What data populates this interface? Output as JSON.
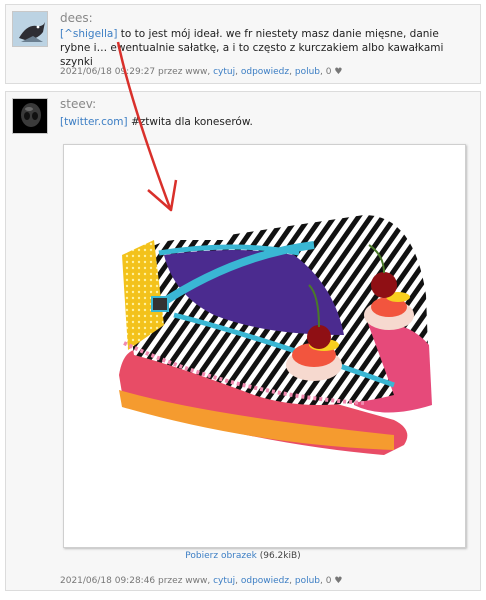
{
  "posts": [
    {
      "author": "dees:",
      "tag": "[^shigella]",
      "text": " to to jest mój ideał. we fr niestety masz danie mięsne, danie rybne i… ewentualnie sałatkę, a i to często z kurczakiem albo kawałkami szynki",
      "timestamp": "2021/06/18 09:29:27 przez www,",
      "actions": {
        "quote": "cytuj",
        "reply": "odpowiedz",
        "like": "polub"
      },
      "likes": "0 ♥"
    },
    {
      "author": "steev:",
      "link": "[twitter.com]",
      "hashtag": "#ztwita",
      "text": " dla koneserów.",
      "image_caption_link": "Pobierz obrazek",
      "image_caption_size": "(96.2kiB)",
      "timestamp": "2021/06/18 09:28:46 przez www,",
      "actions": {
        "quote": "cytuj",
        "reply": "odpowiedz",
        "like": "polub"
      },
      "likes": "0 ♥"
    }
  ],
  "colors": {
    "link": "#3c7ec4",
    "arrow": "#d9302b",
    "background": "#f7f7f7"
  }
}
